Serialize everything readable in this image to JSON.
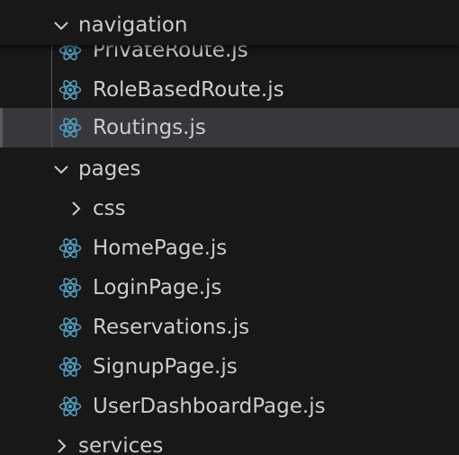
{
  "explorer": {
    "colors": {
      "background": "#181818",
      "text": "#cccccc",
      "selected_row": "#37373d",
      "react_icon": "#519aba",
      "indent_guide": "#585858"
    },
    "sticky_header": {
      "label": "navigation",
      "expanded": true,
      "icon": "chevron-down-icon"
    },
    "navigation_files": [
      {
        "label": "PrivateRoute.js",
        "icon": "react-icon"
      },
      {
        "label": "RoleBasedRoute.js",
        "icon": "react-icon"
      },
      {
        "label": "Routings.js",
        "icon": "react-icon",
        "selected": true
      }
    ],
    "pages_folder": {
      "label": "pages",
      "expanded": true,
      "icon": "chevron-down-icon"
    },
    "css_folder": {
      "label": "css",
      "expanded": false,
      "icon": "chevron-right-icon"
    },
    "pages_files": [
      {
        "label": "HomePage.js",
        "icon": "react-icon"
      },
      {
        "label": "LoginPage.js",
        "icon": "react-icon"
      },
      {
        "label": "Reservations.js",
        "icon": "react-icon"
      },
      {
        "label": "SignupPage.js",
        "icon": "react-icon"
      },
      {
        "label": "UserDashboardPage.js",
        "icon": "react-icon"
      }
    ],
    "services_folder": {
      "label": "services",
      "expanded": false,
      "icon": "chevron-right-icon"
    }
  }
}
